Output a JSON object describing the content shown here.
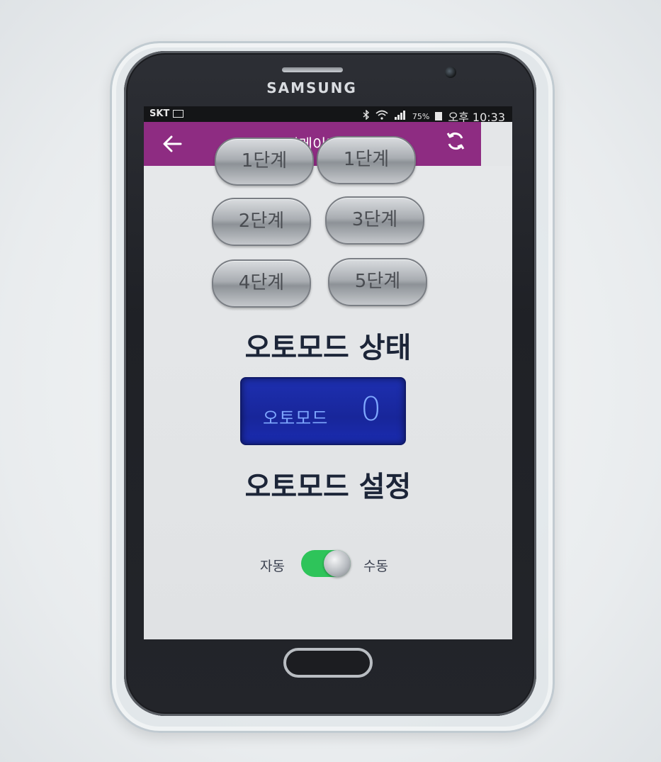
{
  "device": {
    "brand": "SAMSUNG"
  },
  "statusbar": {
    "carrier": "SKT",
    "battery_pct": "75%",
    "time": "오후 10:33"
  },
  "appbar": {
    "title": "미메이커"
  },
  "steps": {
    "partial_left": "1단계",
    "partial_right": "1단계",
    "step2": "2단계",
    "step3": "3단계",
    "step4": "4단계",
    "step5": "5단계"
  },
  "auto_mode_status": {
    "title": "오토모드 상태",
    "label": "오토모드",
    "value": "0"
  },
  "auto_mode_setting": {
    "title": "오토모드 설정",
    "left_label": "자동",
    "right_label": "수동",
    "toggle_on": true
  },
  "colors": {
    "appbar": "#8e2c82",
    "display": "#1d2fb0",
    "toggle": "#2ec45a"
  }
}
